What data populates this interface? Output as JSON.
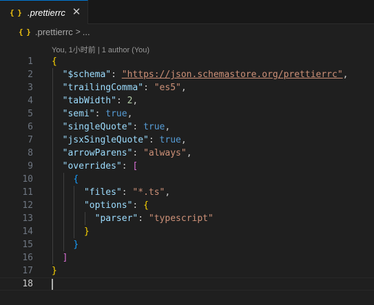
{
  "tab": {
    "icon": "{ }",
    "label": ".prettierrc",
    "close_glyph": "✕"
  },
  "breadcrumb": {
    "icon": "{ }",
    "file": ".prettierrc",
    "separator": ">",
    "more": "..."
  },
  "codelens": "You, 1小时前 | 1 author (You)",
  "colors": {
    "accent": "#0078d4",
    "key": "#9cdcfe",
    "string": "#ce9178",
    "number": "#b5cea8",
    "boolean": "#569cd6",
    "bracket_level1": "#ffd700",
    "bracket_level2": "#da70d6",
    "bracket_level3": "#179fff"
  },
  "lines": [
    {
      "n": "1",
      "indent": 0,
      "tokens": [
        {
          "t": "{",
          "c": "br1"
        }
      ]
    },
    {
      "n": "2",
      "indent": 1,
      "tokens": [
        {
          "t": "\"$schema\"",
          "c": "k"
        },
        {
          "t": ": ",
          "c": "p"
        },
        {
          "t": "\"https://json.schemastore.org/prettierrc\"",
          "c": "s url"
        },
        {
          "t": ",",
          "c": "p"
        }
      ]
    },
    {
      "n": "3",
      "indent": 1,
      "tokens": [
        {
          "t": "\"trailingComma\"",
          "c": "k"
        },
        {
          "t": ": ",
          "c": "p"
        },
        {
          "t": "\"es5\"",
          "c": "s"
        },
        {
          "t": ",",
          "c": "p"
        }
      ]
    },
    {
      "n": "4",
      "indent": 1,
      "tokens": [
        {
          "t": "\"tabWidth\"",
          "c": "k"
        },
        {
          "t": ": ",
          "c": "p"
        },
        {
          "t": "2",
          "c": "n"
        },
        {
          "t": ",",
          "c": "p"
        }
      ]
    },
    {
      "n": "5",
      "indent": 1,
      "tokens": [
        {
          "t": "\"semi\"",
          "c": "k"
        },
        {
          "t": ": ",
          "c": "p"
        },
        {
          "t": "true",
          "c": "b"
        },
        {
          "t": ",",
          "c": "p"
        }
      ]
    },
    {
      "n": "6",
      "indent": 1,
      "tokens": [
        {
          "t": "\"singleQuote\"",
          "c": "k"
        },
        {
          "t": ": ",
          "c": "p"
        },
        {
          "t": "true",
          "c": "b"
        },
        {
          "t": ",",
          "c": "p"
        }
      ]
    },
    {
      "n": "7",
      "indent": 1,
      "tokens": [
        {
          "t": "\"jsxSingleQuote\"",
          "c": "k"
        },
        {
          "t": ": ",
          "c": "p"
        },
        {
          "t": "true",
          "c": "b"
        },
        {
          "t": ",",
          "c": "p"
        }
      ]
    },
    {
      "n": "8",
      "indent": 1,
      "tokens": [
        {
          "t": "\"arrowParens\"",
          "c": "k"
        },
        {
          "t": ": ",
          "c": "p"
        },
        {
          "t": "\"always\"",
          "c": "s"
        },
        {
          "t": ",",
          "c": "p"
        }
      ]
    },
    {
      "n": "9",
      "indent": 1,
      "tokens": [
        {
          "t": "\"overrides\"",
          "c": "k"
        },
        {
          "t": ": ",
          "c": "p"
        },
        {
          "t": "[",
          "c": "br2"
        }
      ]
    },
    {
      "n": "10",
      "indent": 2,
      "tokens": [
        {
          "t": "{",
          "c": "br3"
        }
      ]
    },
    {
      "n": "11",
      "indent": 3,
      "tokens": [
        {
          "t": "\"files\"",
          "c": "k"
        },
        {
          "t": ": ",
          "c": "p"
        },
        {
          "t": "\"*.ts\"",
          "c": "s"
        },
        {
          "t": ",",
          "c": "p"
        }
      ]
    },
    {
      "n": "12",
      "indent": 3,
      "tokens": [
        {
          "t": "\"options\"",
          "c": "k"
        },
        {
          "t": ": ",
          "c": "p"
        },
        {
          "t": "{",
          "c": "br1"
        }
      ]
    },
    {
      "n": "13",
      "indent": 4,
      "tokens": [
        {
          "t": "\"parser\"",
          "c": "k"
        },
        {
          "t": ": ",
          "c": "p"
        },
        {
          "t": "\"typescript\"",
          "c": "s"
        }
      ]
    },
    {
      "n": "14",
      "indent": 3,
      "tokens": [
        {
          "t": "}",
          "c": "br1"
        }
      ]
    },
    {
      "n": "15",
      "indent": 2,
      "tokens": [
        {
          "t": "}",
          "c": "br3"
        }
      ]
    },
    {
      "n": "16",
      "indent": 1,
      "tokens": [
        {
          "t": "]",
          "c": "br2"
        }
      ]
    },
    {
      "n": "17",
      "indent": 0,
      "tokens": [
        {
          "t": "}",
          "c": "br1"
        }
      ]
    },
    {
      "n": "18",
      "indent": 0,
      "tokens": [],
      "current": true
    }
  ]
}
